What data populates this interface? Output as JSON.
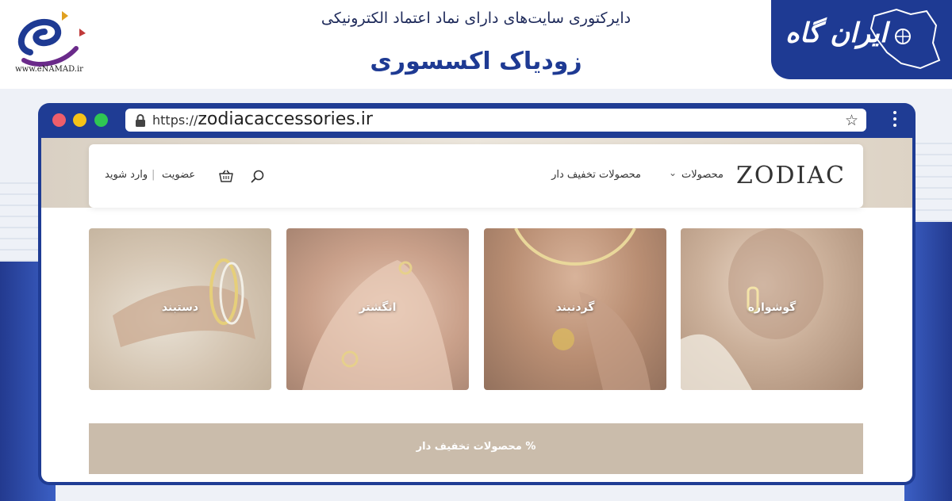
{
  "header": {
    "enamad_url": "www.eNAMAD.ir",
    "subtitle": "دایرکتوری سایت‌های دارای نماد اعتماد الکترونیکی",
    "title": "زودیاک اکسسوری",
    "brand": "ایران گاه"
  },
  "browser": {
    "url_protocol": "https://",
    "url_domain": "zodiacaccessories.ir",
    "colors": {
      "frame": "#1f3c94",
      "close": "#ee5e6b",
      "minimize": "#f5c218",
      "maximize": "#2fc653"
    }
  },
  "site": {
    "logo": "ZODIAC",
    "nav": {
      "products": "محصولات",
      "discounted": "محصولات تخفیف دار",
      "register": "عضویت",
      "separator": "|",
      "login": "وارد شوید"
    },
    "categories": [
      {
        "label": "گوشواره"
      },
      {
        "label": "گردنبند"
      },
      {
        "label": "انگشتر"
      },
      {
        "label": "دستبند"
      }
    ],
    "banner": "محصولات تخفیف دار %",
    "colors": {
      "accent": "#cabcab",
      "hero": "#d9d0c3"
    }
  }
}
